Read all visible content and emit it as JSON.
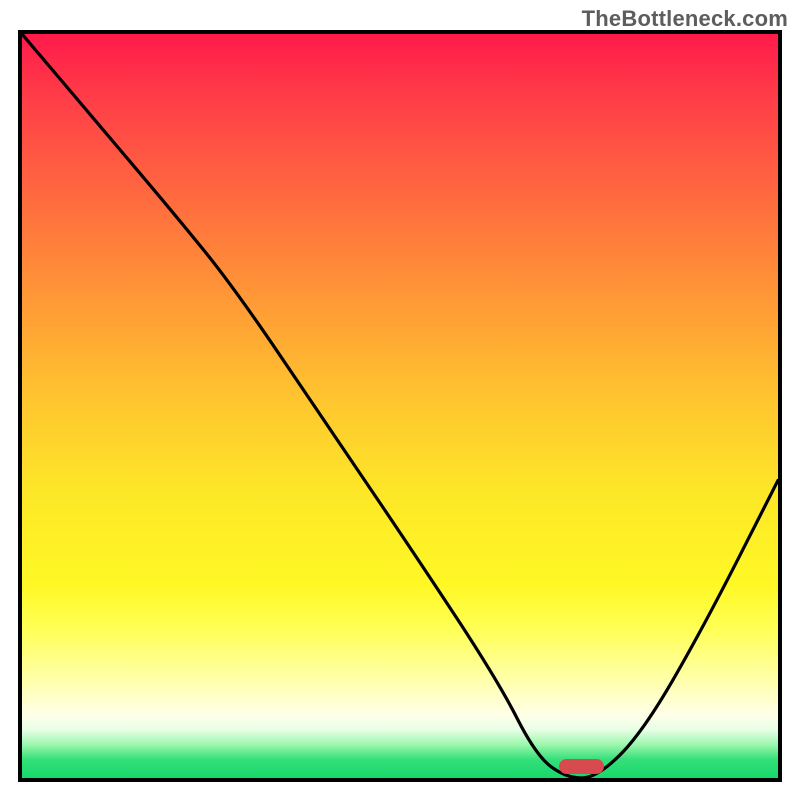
{
  "watermark": "TheBottleneck.com",
  "colors": {
    "border": "#000000",
    "curve": "#000000",
    "marker": "#d84a4f",
    "gradient_stops": [
      "#ff1a4a",
      "#ff3b48",
      "#ff6a3f",
      "#ff9a36",
      "#ffc82e",
      "#fde827",
      "#fff825",
      "#ffff56",
      "#ffffa0",
      "#ffffe8",
      "#e8ffe6",
      "#9df7ac",
      "#34e07a",
      "#17d86a"
    ]
  },
  "chart_data": {
    "type": "line",
    "title": "",
    "xlabel": "",
    "ylabel": "",
    "xlim": [
      0,
      100
    ],
    "ylim": [
      0,
      100
    ],
    "grid": false,
    "legend": false,
    "annotations": [],
    "background_gradient": {
      "orientation": "vertical",
      "top_color": "red",
      "middle_color": "yellow",
      "bottom_color": "green",
      "semantics": "bottleneck_severity_top_bad_bottom_good"
    },
    "marker": {
      "x_start": 71,
      "x_end": 77,
      "y": 0,
      "color": "#d84a4f"
    },
    "series": [
      {
        "name": "bottleneck-curve",
        "x": [
          0,
          10,
          20,
          28,
          40,
          52,
          63,
          68,
          72,
          76,
          82,
          90,
          100
        ],
        "y": [
          100,
          88,
          76,
          66,
          48,
          30,
          13,
          3,
          0,
          0,
          6,
          20,
          40
        ]
      }
    ],
    "notes": "V-shaped decreasing-then-increasing curve over a red→yellow→green vertical heat gradient. Curve minimum (green zone) occurs roughly between x≈71 and x≈77, where a small red pill marker sits on the floor. Y values estimated from vertical position relative to full plot height (0=bottom, 100=top); no numeric axis labels are present in the image."
  }
}
